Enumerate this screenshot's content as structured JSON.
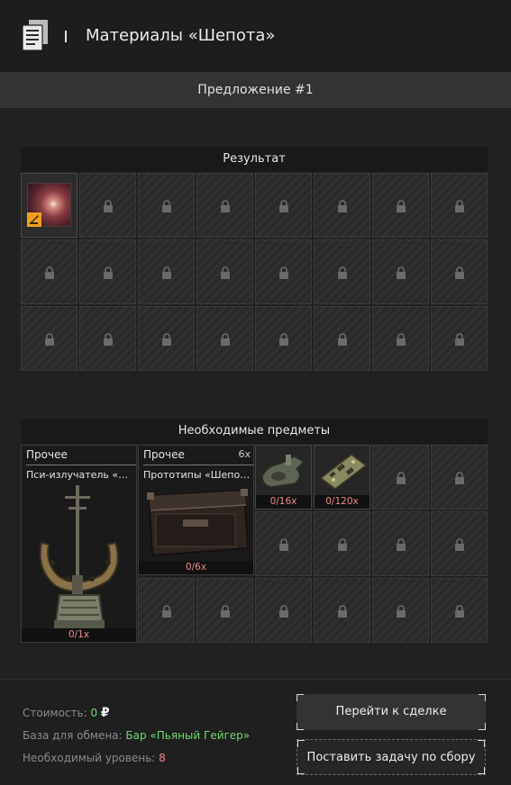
{
  "header": {
    "icon": "documents-icon",
    "title": "Материалы «Шепота»"
  },
  "offer": {
    "label": "Предложение #1"
  },
  "result": {
    "title": "Результат",
    "item": {
      "icon": "anomaly-artifact-icon",
      "badge_icon": "blueprint-badge-icon"
    },
    "locked_icon": "lock-icon"
  },
  "required": {
    "title": "Необходимые предметы",
    "items": [
      {
        "category": "Прочее",
        "name": "Пси-излучатель «Шепота»",
        "count": "0/1x",
        "icon": "psi-emitter-icon"
      },
      {
        "category": "Прочее",
        "quantity": "6x",
        "name": "Прототипы «Шепота»",
        "count": "0/6x",
        "icon": "crate-icon"
      },
      {
        "count": "0/16x",
        "icon": "device-part-icon"
      },
      {
        "count": "0/120x",
        "icon": "circuit-board-icon"
      }
    ]
  },
  "footer": {
    "cost_label": "Стоимость:",
    "cost_value": "0",
    "currency": "₽",
    "base_label": "База для обмена:",
    "base_value": "Бар «Пьяный Гейгер»",
    "level_label": "Необходимый уровень:",
    "level_value": "8",
    "go_to_deal": "Перейти к сделке",
    "set_task": "Поставить задачу по сбору"
  },
  "colors": {
    "accent_green": "#6fd86f",
    "accent_red": "#e98a86",
    "badge": "#f0a020"
  }
}
